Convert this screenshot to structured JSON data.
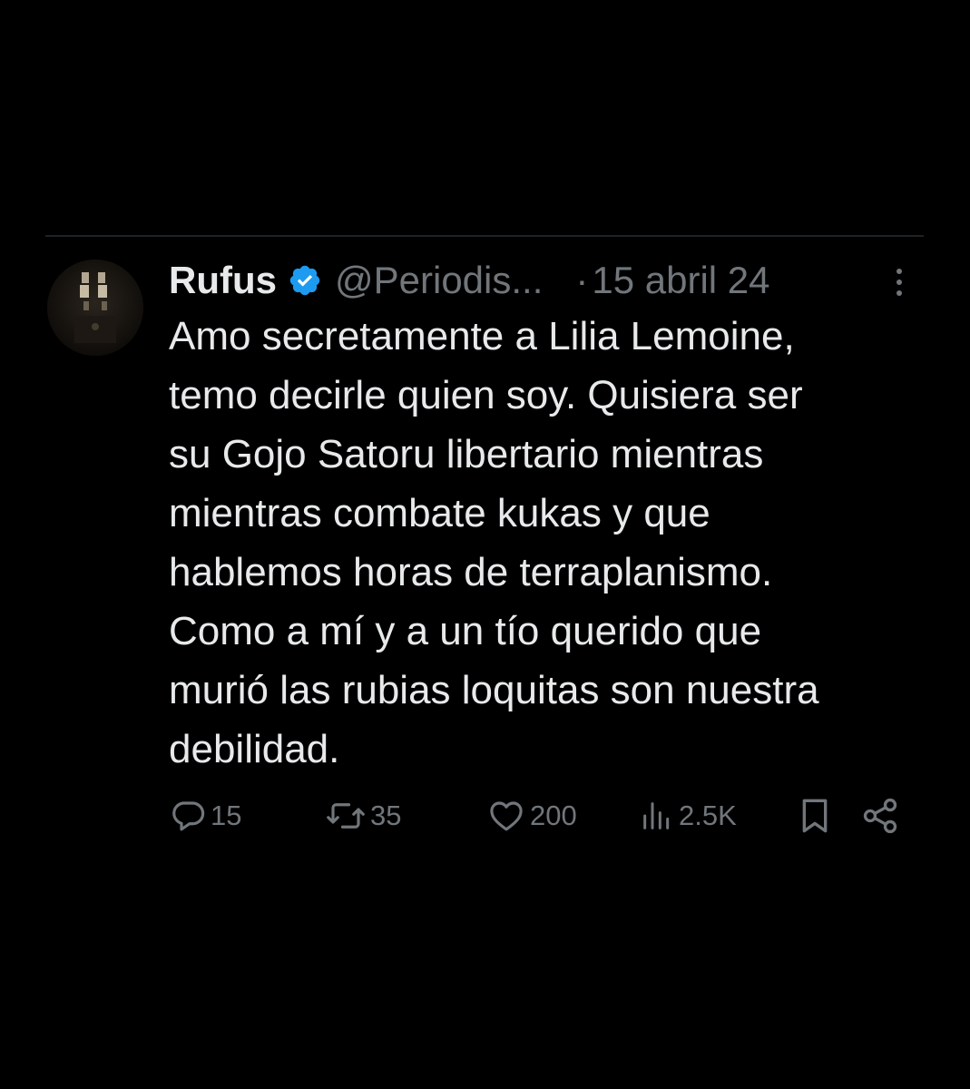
{
  "tweet": {
    "author_name": "Rufus",
    "handle": "@Periodis...",
    "separator": "·",
    "date": "15 abril 24",
    "body_lines": [
      "Amo secretamente a Lilia Lemoine,",
      "temo decirle quien soy. Quisiera ser",
      "su Gojo Satoru libertario mientras",
      "mientras combate kukas y que",
      "hablemos horas de terraplanismo.",
      "Como a mí y a un tío querido que",
      "murió las rubias loquitas son nuestra",
      "debilidad."
    ],
    "verified_color": "#1d9bf0"
  },
  "actions": {
    "replies": "15",
    "retweets": "35",
    "likes": "200",
    "views": "2.5K"
  },
  "icons": {
    "verified": "verified-badge-icon",
    "more": "more-options-icon",
    "reply": "reply-icon",
    "retweet": "retweet-icon",
    "like": "heart-icon",
    "views": "views-chart-icon",
    "bookmark": "bookmark-icon",
    "share": "share-icon"
  },
  "colors": {
    "background": "#000000",
    "text": "#e7e9ea",
    "secondary": "#71767b",
    "divider": "#1f2326"
  }
}
